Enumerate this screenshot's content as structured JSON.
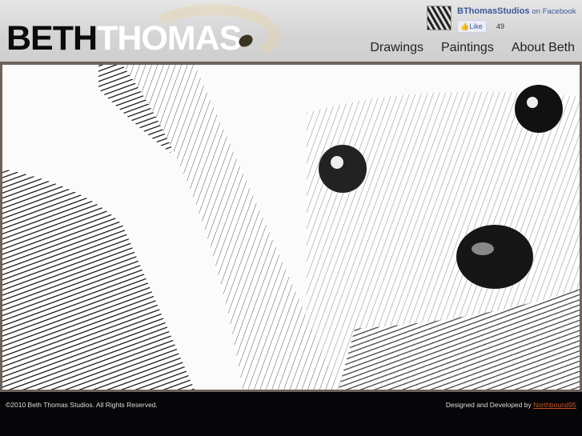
{
  "logo": {
    "first": "BETH",
    "last": "THOMAS"
  },
  "facebook": {
    "page_name": "BThomasStudios",
    "suffix": "on Facebook",
    "like_label": "Like",
    "like_count": "49"
  },
  "nav": [
    "Drawings",
    "Paintings",
    "About Beth"
  ],
  "footer": {
    "copyright": "©2010 Beth Thomas Studios. All Rights Reserved.",
    "credit_prefix": "Designed and Developed by",
    "credit_link": "Northbound95"
  },
  "colors": {
    "frame": "#6e635b",
    "footer_bg": "#060508",
    "link": "#d2521d",
    "facebook": "#3b5998"
  }
}
